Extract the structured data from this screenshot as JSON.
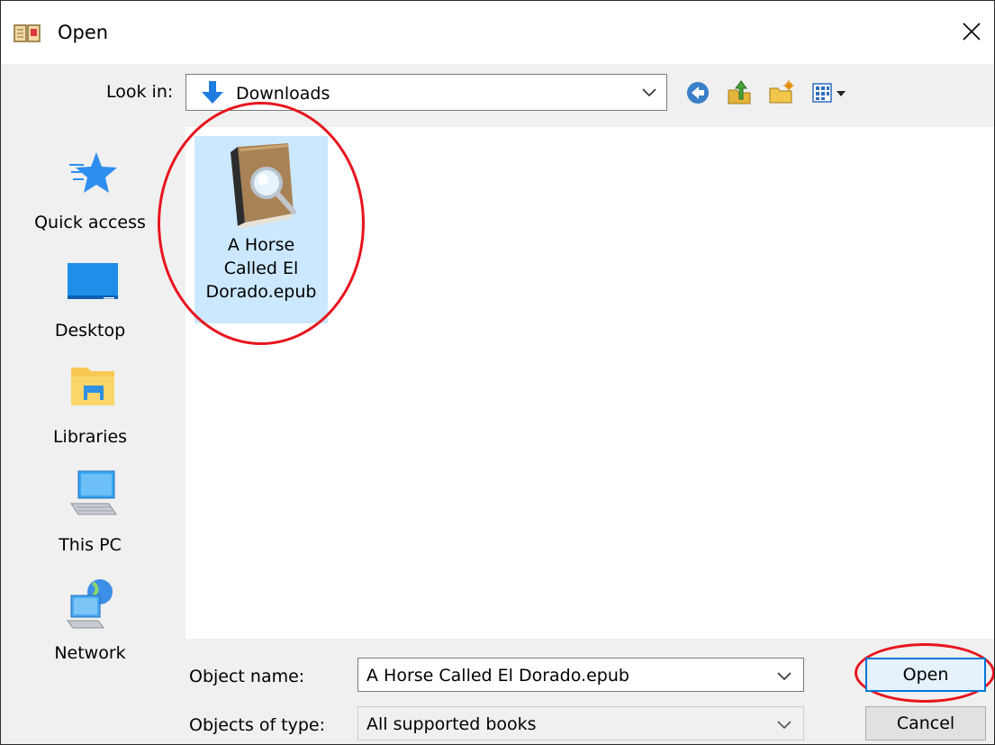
{
  "window": {
    "title": "Open",
    "close_glyph": "✕"
  },
  "lookin": {
    "label": "Look in:",
    "value": "Downloads"
  },
  "toolbar": {
    "back_icon": "back-arrow-icon",
    "up_icon": "up-folder-icon",
    "new_folder_icon": "new-folder-icon",
    "view_icon": "view-menu-icon"
  },
  "places": [
    {
      "label": "Quick access",
      "icon": "quick-access-star-icon"
    },
    {
      "label": "Desktop",
      "icon": "desktop-icon"
    },
    {
      "label": "Libraries",
      "icon": "libraries-folder-icon"
    },
    {
      "label": "This PC",
      "icon": "computer-icon"
    },
    {
      "label": "Network",
      "icon": "network-icon"
    }
  ],
  "files": [
    {
      "name_line1": "A Horse",
      "name_line2": "Called El",
      "name_line3": "Dorado.epub",
      "icon": "ebook-icon",
      "selected": true
    }
  ],
  "form": {
    "object_name_label": "Object name:",
    "object_name_value": "A Horse Called El Dorado.epub",
    "object_type_label": "Objects of type:",
    "object_type_value": "All supported books"
  },
  "buttons": {
    "open": "Open",
    "cancel": "Cancel"
  },
  "colors": {
    "selection": "#cce8ff",
    "annotation": "#e8141e",
    "accent": "#0078d7"
  }
}
